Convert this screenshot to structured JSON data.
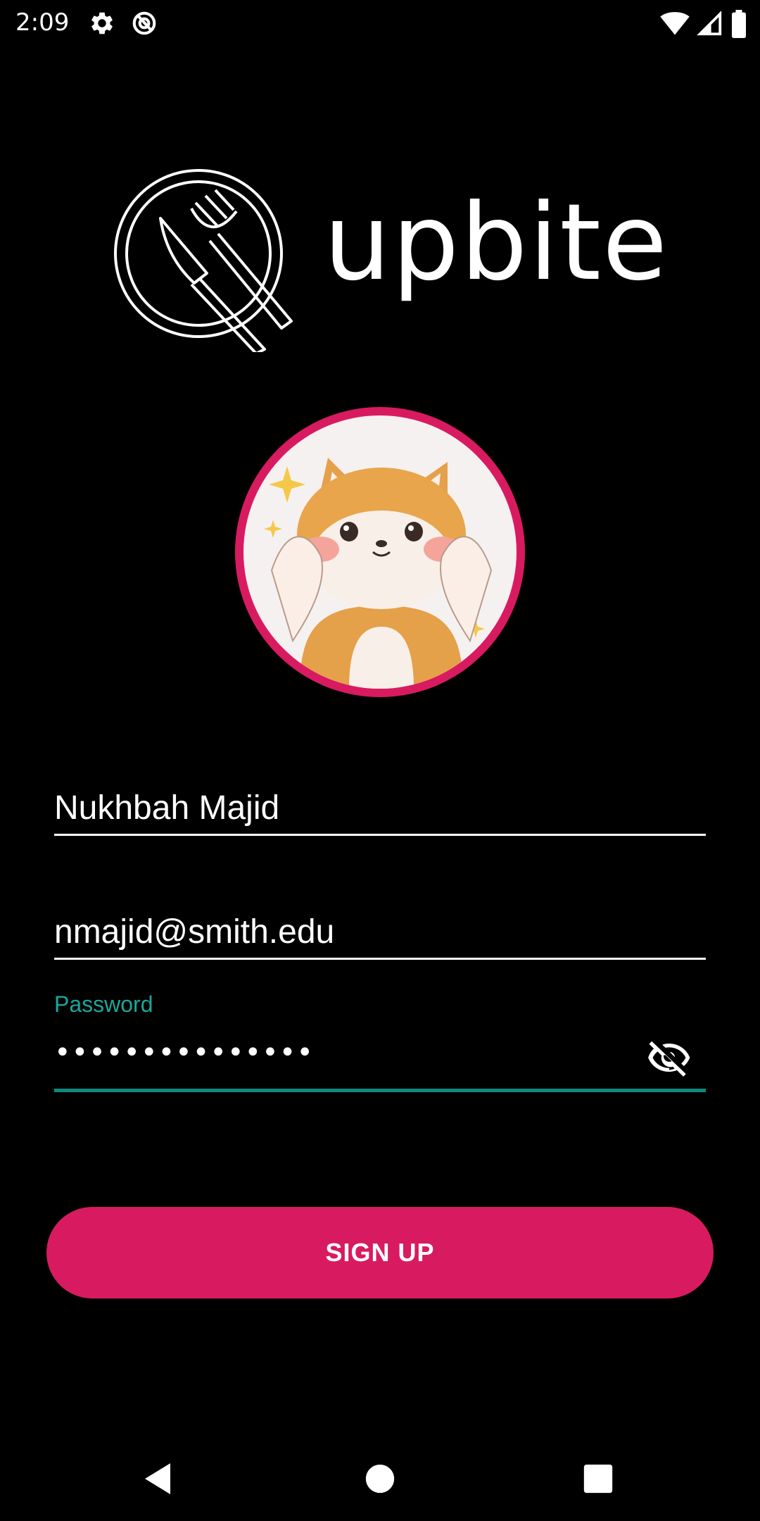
{
  "status_bar": {
    "time": "2:09",
    "icons": [
      "settings-icon",
      "data-saver-icon",
      "wifi-icon",
      "signal-icon",
      "battery-icon"
    ]
  },
  "brand": {
    "name": "upbite",
    "logo_icon": "plate-fork-knife-icon"
  },
  "avatar": {
    "description_icon": "profile-avatar",
    "ring_color": "#d81b60"
  },
  "form": {
    "name_value": "Nukhbah Majid",
    "email_value": "nmajid@smith.edu",
    "password_label": "Password",
    "password_masked": "•••••••••••••••",
    "password_toggle_icon": "eye-off-icon",
    "accent_color": "#0e8a7d"
  },
  "actions": {
    "signup_label": "SIGN UP",
    "button_color": "#d81b60"
  },
  "nav": {
    "icons": [
      "back-icon",
      "home-icon",
      "recents-icon"
    ]
  }
}
